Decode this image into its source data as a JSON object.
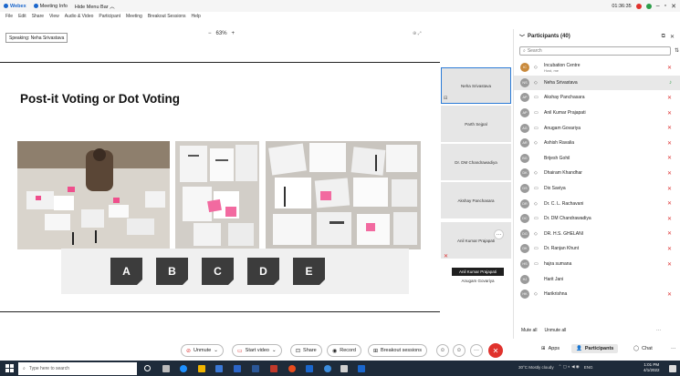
{
  "titlebar": {
    "app": "Webex",
    "meeting_info": "Meeting Info",
    "hide_menu": "Hide Menu Bar ︿",
    "timer": "01:36:35"
  },
  "menu": [
    "File",
    "Edit",
    "Share",
    "View",
    "Audio & Video",
    "Participant",
    "Meeting",
    "Breakout Sessions",
    "Help"
  ],
  "speaking": "Speaking: Neha Srivastava",
  "zoom": {
    "minus": "−",
    "level": "63%",
    "plus": "+"
  },
  "slide": {
    "title": "Post-it Voting or Dot Voting",
    "letters": [
      "A",
      "B",
      "C",
      "D",
      "E"
    ]
  },
  "tiles": [
    {
      "name": "Neha Srivastava",
      "active": true
    },
    {
      "name": "Parth Sejpal"
    },
    {
      "name": "Dr. DM Chandrawadiya"
    },
    {
      "name": "Akshay Panchasara"
    },
    {
      "name": "Anil Kumar Prajapati"
    }
  ],
  "tile_tags": {
    "dark": "Anil Kumar Prajapati",
    "light": "Anugam Govariya"
  },
  "panel": {
    "title": "Participants (40)",
    "search_placeholder": "Search",
    "participants": [
      {
        "initials": "IC",
        "name": "Incubation Centre",
        "sub": "Host, me",
        "device": "◇",
        "mute": "✕"
      },
      {
        "initials": "NS",
        "name": "Neha Srivastava",
        "sub": "",
        "device": "◇",
        "mute": "♪",
        "selected": true
      },
      {
        "initials": "AP",
        "name": "Akshay Panchasara",
        "sub": "",
        "device": "▭",
        "mute": "✕"
      },
      {
        "initials": "AP",
        "name": "Anil Kumar Prajapati",
        "sub": "",
        "device": "▭",
        "mute": "✕"
      },
      {
        "initials": "AG",
        "name": "Anugam Govariya",
        "sub": "",
        "device": "▭",
        "mute": "✕"
      },
      {
        "initials": "AR",
        "name": "Ashish Ravalia",
        "sub": "",
        "device": "◇",
        "mute": "✕"
      },
      {
        "initials": "BG",
        "name": "Brijesh Gohil",
        "sub": "",
        "device": "",
        "mute": "✕"
      },
      {
        "initials": "DK",
        "name": "Dhairam Khandhar",
        "sub": "",
        "device": "◇",
        "mute": "✕"
      },
      {
        "initials": "DS",
        "name": "Dix Saviya",
        "sub": "",
        "device": "▭",
        "mute": "✕"
      },
      {
        "initials": "DR",
        "name": "Dr. C. L. Rachavani",
        "sub": "",
        "device": "◇",
        "mute": "✕"
      },
      {
        "initials": "DC",
        "name": "Dr. DM Chandrawadiya",
        "sub": "",
        "device": "▭",
        "mute": "✕"
      },
      {
        "initials": "DG",
        "name": "DR. H.S. GHELANI",
        "sub": "",
        "device": "◇",
        "mute": "✕"
      },
      {
        "initials": "DK",
        "name": "Dr. Ranjan Khunt",
        "sub": "",
        "device": "▭",
        "mute": "✕"
      },
      {
        "initials": "HS",
        "name": "hajra sumana",
        "sub": "",
        "device": "▭",
        "mute": "✕"
      },
      {
        "initials": "HJ",
        "name": "Harit Jani",
        "sub": "",
        "device": "",
        "mute": ""
      },
      {
        "initials": "HK",
        "name": "Harikrishna",
        "sub": "",
        "device": "◇",
        "mute": "✕"
      }
    ],
    "mute_all": "Mute all",
    "unmute_all": "Unmute all"
  },
  "controls": {
    "unmute": "Unmute",
    "start_video": "Start video",
    "share": "Share",
    "record": "Record",
    "breakout": "Breakout sessions",
    "apps": "Apps",
    "participants": "Participants",
    "chat": "Chat"
  },
  "taskbar": {
    "search_placeholder": "Type here to search",
    "weather": "30°C  Mostly cloudy",
    "lang": "ENG",
    "time": "1:01 PM",
    "date": "4/1/2022"
  },
  "colors": {
    "accent": "#1a66cc",
    "end": "#e0322d",
    "mute": "#d33333",
    "taskbar": "#1e2b3a"
  }
}
